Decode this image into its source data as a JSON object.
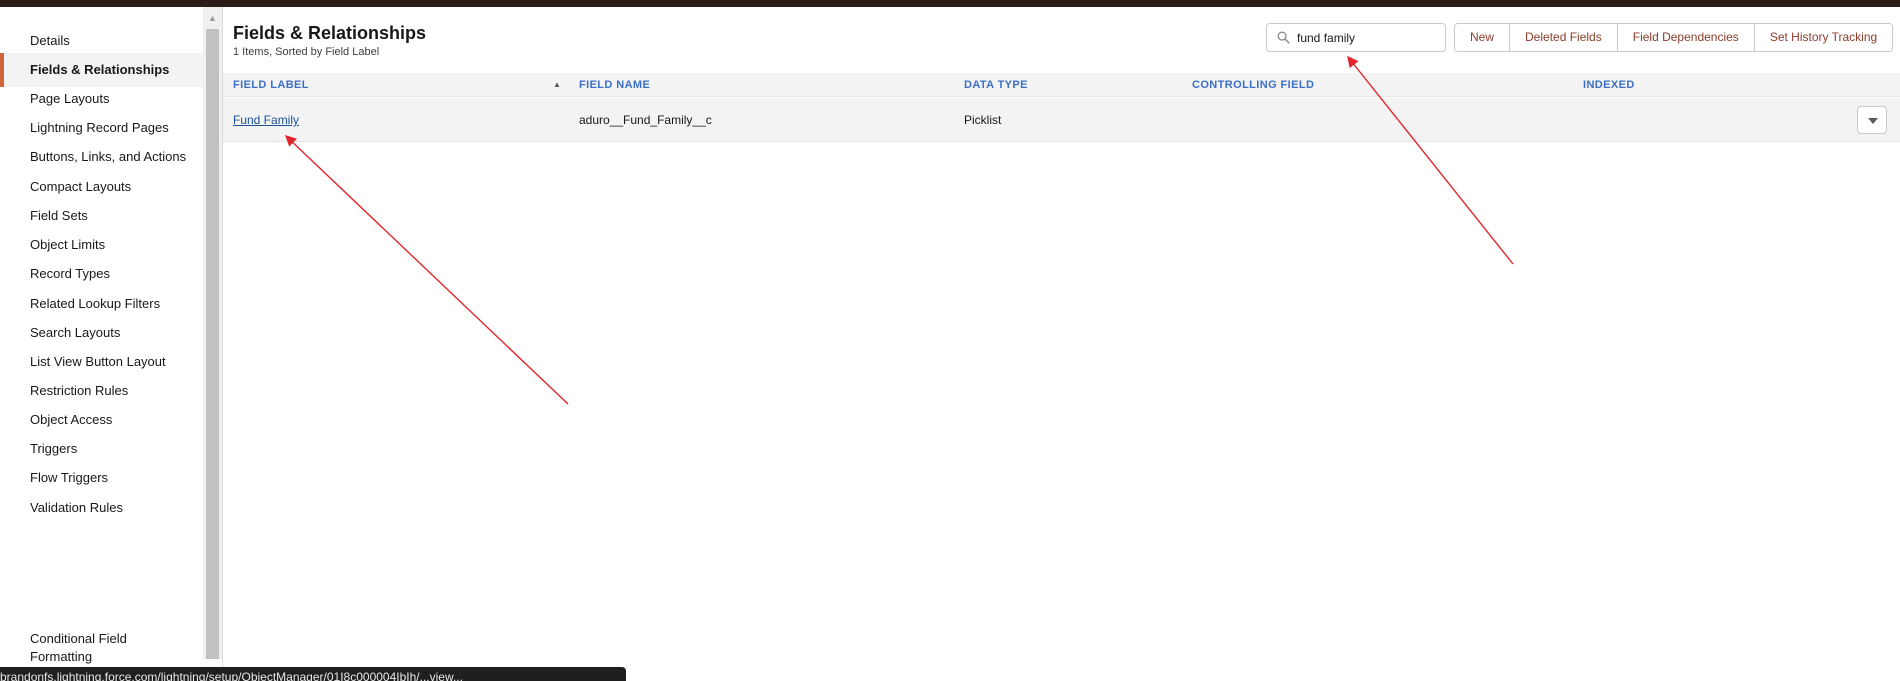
{
  "sidebar": {
    "items": [
      {
        "label": "Details"
      },
      {
        "label": "Fields & Relationships"
      },
      {
        "label": "Page Layouts"
      },
      {
        "label": "Lightning Record Pages"
      },
      {
        "label": "Buttons, Links, and Actions"
      },
      {
        "label": "Compact Layouts"
      },
      {
        "label": "Field Sets"
      },
      {
        "label": "Object Limits"
      },
      {
        "label": "Record Types"
      },
      {
        "label": "Related Lookup Filters"
      },
      {
        "label": "Search Layouts"
      },
      {
        "label": "List View Button Layout"
      },
      {
        "label": "Restriction Rules"
      },
      {
        "label": "Object Access"
      },
      {
        "label": "Triggers"
      },
      {
        "label": "Flow Triggers"
      },
      {
        "label": "Validation Rules"
      },
      {
        "label": "Conditional Field Formatting"
      }
    ],
    "active_label": "Fields & Relationships"
  },
  "header": {
    "title": "Fields & Relationships",
    "subtitle": "1 Items, Sorted by Field Label"
  },
  "search": {
    "value": "fund family"
  },
  "toolbar": {
    "new_label": "New",
    "deleted_fields_label": "Deleted Fields",
    "field_dependencies_label": "Field Dependencies",
    "set_history_tracking_label": "Set History Tracking"
  },
  "table": {
    "columns": [
      "FIELD LABEL",
      "FIELD NAME",
      "DATA TYPE",
      "CONTROLLING FIELD",
      "INDEXED"
    ],
    "sorted_by": "FIELD LABEL",
    "rows": [
      {
        "field_label": "Fund Family",
        "field_name": "aduro__Fund_Family__c",
        "data_type": "Picklist",
        "controlling_field": "",
        "indexed": ""
      }
    ]
  },
  "status_bar": {
    "url": "brandonfs.lightning.force.com/lightning/setup/ObjectManager/01I8c000004IbIh/...view..."
  },
  "colors": {
    "accent": "#d0643a",
    "link": "#1b5297",
    "header_text": "#3c6fc6",
    "button_text": "#8a3d2a",
    "annotation": "#e0262a"
  }
}
